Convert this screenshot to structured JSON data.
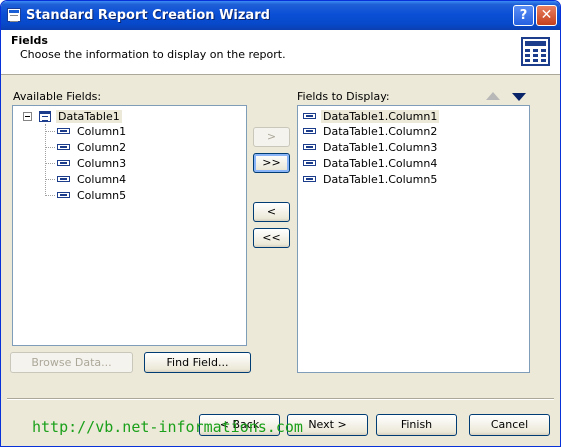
{
  "window": {
    "title": "Standard Report Creation Wizard",
    "help_glyph": "?",
    "close_glyph": "✕"
  },
  "header": {
    "title": "Fields",
    "description": "Choose the information to display on the report."
  },
  "available": {
    "label": "Available Fields:",
    "root": "DataTable1",
    "columns": [
      "Column1",
      "Column2",
      "Column3",
      "Column4",
      "Column5"
    ]
  },
  "display": {
    "label": "Fields to Display:",
    "items": [
      "DataTable1.Column1",
      "DataTable1.Column2",
      "DataTable1.Column3",
      "DataTable1.Column4",
      "DataTable1.Column5"
    ]
  },
  "transfer": {
    "add_one": ">",
    "add_all": ">>",
    "remove_one": "<",
    "remove_all": "<<"
  },
  "buttons": {
    "browse_data": "Browse Data...",
    "find_field": "Find Field...",
    "back": "< Back",
    "next": "Next >",
    "finish": "Finish",
    "cancel": "Cancel"
  },
  "watermark": "http://vb.net-informations.com",
  "colors": {
    "titlebar": "#0a4fd6",
    "dialog_bg": "#ece9d8",
    "watermark": "#1aa01a"
  }
}
